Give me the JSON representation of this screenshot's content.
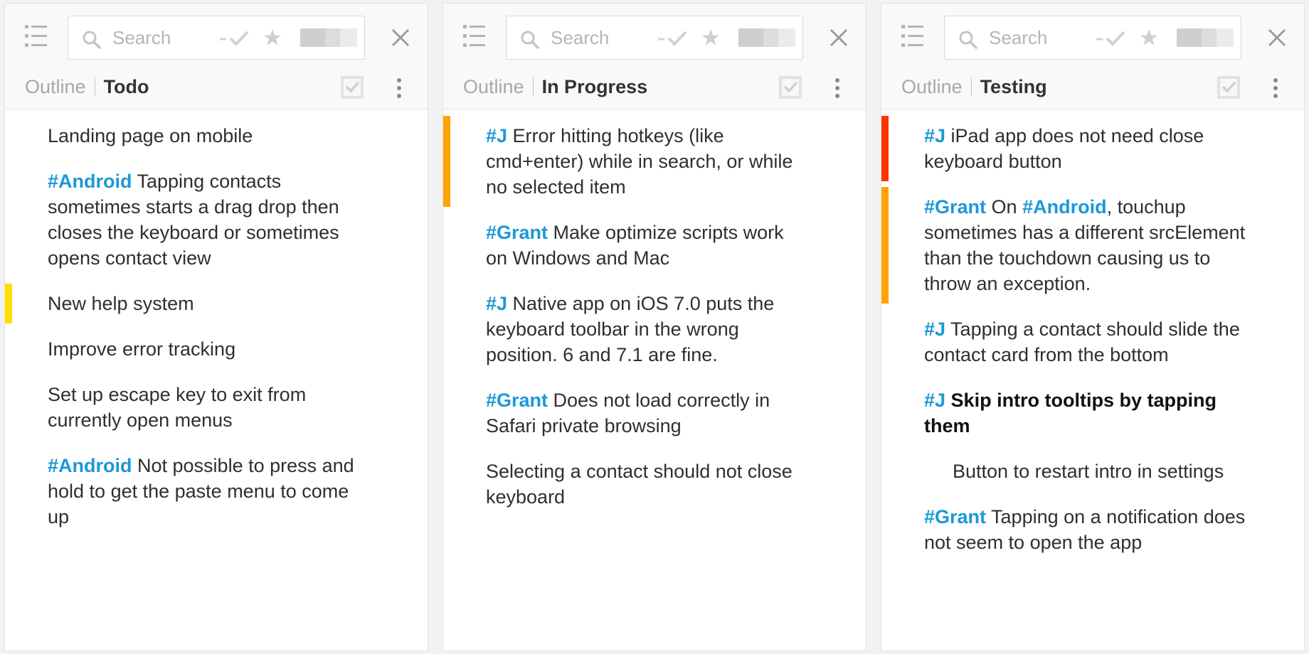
{
  "colors": {
    "tag": "#1c98d8",
    "bar_yellow": "#ffde00",
    "bar_orange": "#ffa400",
    "bar_red": "#ff3300"
  },
  "panels": [
    {
      "search": {
        "placeholder": "Search",
        "value": ""
      },
      "breadcrumb": {
        "outline": "Outline",
        "title": "Todo"
      },
      "items": [
        {
          "text": "Landing page on mobile"
        },
        {
          "tag": "#Android",
          "text": " Tapping contacts sometimes starts a drag drop then closes the keyboard or sometimes opens contact view"
        },
        {
          "text": "New help system",
          "bar": "yellow"
        },
        {
          "text": "Improve error tracking"
        },
        {
          "text": "Set up escape key to exit from currently open menus"
        },
        {
          "tag": "#Android",
          "text": " Not possible to press and hold to get the paste menu to come up"
        }
      ]
    },
    {
      "search": {
        "placeholder": "Search",
        "value": ""
      },
      "breadcrumb": {
        "outline": "Outline",
        "title": "In Progress"
      },
      "items": [
        {
          "tag": "#J",
          "text": " Error hitting hotkeys (like cmd+enter) while in search, or while no selected item",
          "bar": "orange"
        },
        {
          "tag": "#Grant",
          "text": " Make optimize scripts work on Windows and Mac"
        },
        {
          "tag": "#J",
          "text": " Native app on iOS 7.0 puts the keyboard toolbar in the wrong position. 6 and 7.1 are fine."
        },
        {
          "tag": "#Grant",
          "text": " Does not load correctly in Safari private browsing"
        },
        {
          "text": "Selecting a contact should not close keyboard"
        }
      ]
    },
    {
      "search": {
        "placeholder": "Search",
        "value": ""
      },
      "breadcrumb": {
        "outline": "Outline",
        "title": "Testing"
      },
      "items": [
        {
          "tag": "#J",
          "text": " iPad app does not need close keyboard button",
          "bar": "red"
        },
        {
          "tag": "#Grant",
          "text": " On ",
          "tag2": "#Android",
          "text2": ", touchup sometimes has a different srcElement than the touchdown causing us to throw an exception.",
          "bar": "orange"
        },
        {
          "tag": "#J",
          "text": " Tapping a contact should slide the contact card from the bottom"
        },
        {
          "tag": "#J",
          "text": " Skip intro tooltips by tapping them",
          "bold": true
        },
        {
          "text": "Button to restart intro in settings",
          "indent": true
        },
        {
          "tag": "#Grant",
          "text": " Tapping on a notification does not seem to open the app"
        }
      ]
    }
  ]
}
